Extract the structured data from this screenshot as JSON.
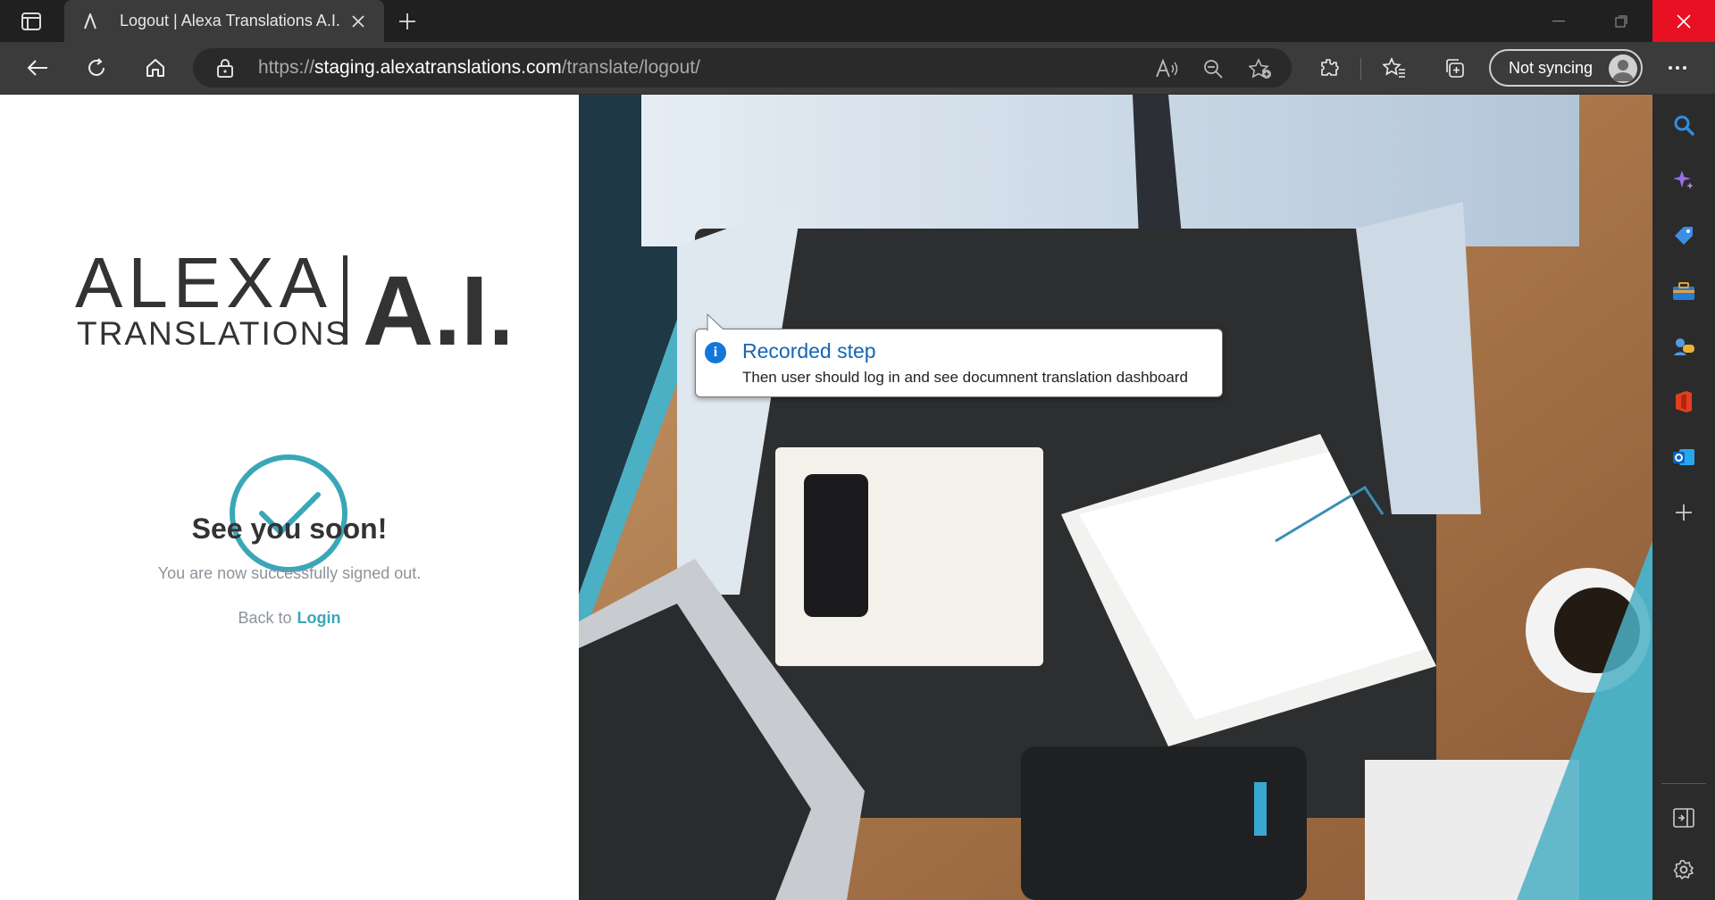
{
  "browser": {
    "tab": {
      "title": "Logout | Alexa Translations A.I.",
      "favicon": "alexa-logo-glyph"
    },
    "url": {
      "scheme": "https://",
      "host": "staging.alexatranslations.com",
      "path": "/translate/logout/"
    },
    "profile": {
      "sync_label": "Not syncing"
    }
  },
  "page": {
    "logo": {
      "brand": "ALEXA",
      "sub": "TRANSLATIONS",
      "mark": "A.I."
    },
    "heading": "See you soon!",
    "subtext": "You are now successfully signed out.",
    "back_prefix": "Back to",
    "login_link": "Login",
    "accent_color": "#3aa7b8"
  },
  "callout": {
    "title": "Recorded step",
    "body": "Then user should log in and see documnent translation dashboard"
  },
  "sidebar": {
    "items": [
      "search-icon",
      "copilot-icon",
      "shopping-tag-icon",
      "tools-icon",
      "games-icon",
      "office-icon",
      "outlook-icon",
      "add-icon",
      "hide-sidebar-icon",
      "settings-icon"
    ]
  }
}
